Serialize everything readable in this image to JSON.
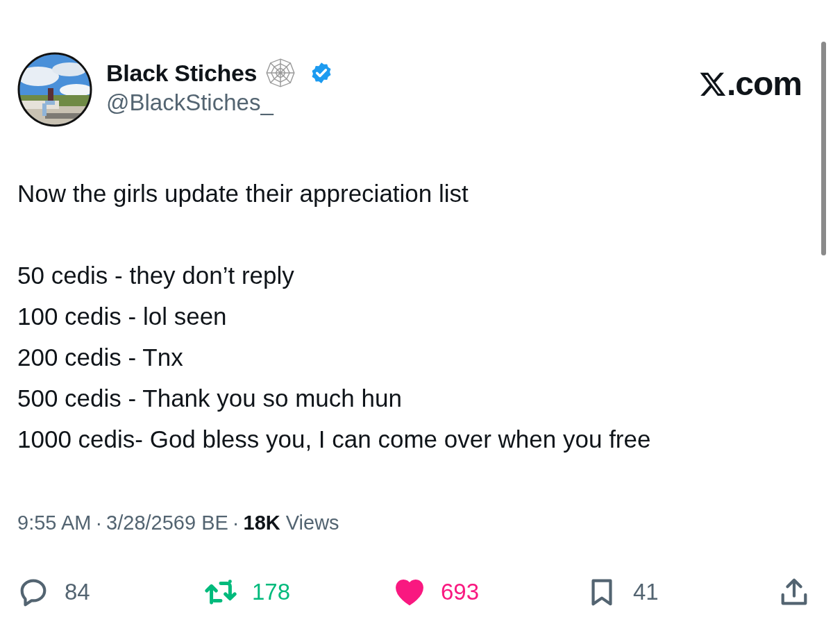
{
  "author": {
    "name": "Black Stiches",
    "handle": "@BlackStiches_",
    "verified": true
  },
  "site": ".com",
  "post": {
    "intro": "Now the girls update their appreciation list",
    "lines": [
      "50 cedis - they don’t reply",
      "100 cedis - lol seen",
      "200 cedis - Tnx",
      "500 cedis - Thank you so much hun",
      "1000 cedis- God bless you, I can come over when you free"
    ]
  },
  "meta": {
    "time": "9:55 AM",
    "separator_1": "·",
    "date": "3/28/2569 BE",
    "separator_2": "·",
    "views_count": "18K",
    "views_label": "Views"
  },
  "actions": [
    {
      "kind": "reply",
      "count": "84",
      "active": false
    },
    {
      "kind": "repost",
      "count": "178",
      "active": true
    },
    {
      "kind": "like",
      "count": "693",
      "active": true
    },
    {
      "kind": "bookmark",
      "count": "41",
      "active": false
    },
    {
      "kind": "share",
      "active": false
    }
  ]
}
